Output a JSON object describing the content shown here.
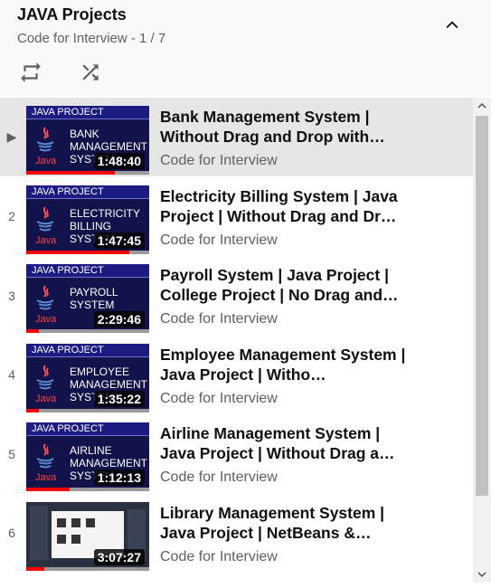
{
  "playlist": {
    "title": "JAVA Projects",
    "subtitle": "Code for Interview - 1 / 7",
    "icons": {
      "collapse": "chevron-up-icon",
      "loop": "loop-icon",
      "shuffle": "shuffle-icon",
      "now_playing": "play-arrow-icon"
    }
  },
  "items": [
    {
      "index": "▶",
      "title": "Bank Management System | Without Drag and Drop with…",
      "channel": "Code for Interview",
      "duration": "1:48:40",
      "banner": "JAVA PROJECT",
      "thumb_text": "BANK\nMANAGEMENT\nSYSTEM",
      "java": "Java",
      "progress": 0.72,
      "active": true
    },
    {
      "index": "2",
      "title": "Electricity Billing System | Java Project | Without Drag and Dr…",
      "channel": "Code for Interview",
      "duration": "1:47:45",
      "banner": "JAVA PROJECT",
      "thumb_text": "ELECTRICITY\nBILLING\nSYSTEM",
      "java": "Java",
      "progress": 0.84
    },
    {
      "index": "3",
      "title": "Payroll System | Java Project | College Project | No Drag and…",
      "channel": "Code for Interview",
      "duration": "2:29:46",
      "banner": "JAVA PROJECT",
      "thumb_text": "PAYROLL\nSYSTEM",
      "java": "Java",
      "progress": 0.1
    },
    {
      "index": "4",
      "title": "Employee Management System | Java Project | Witho…",
      "channel": "Code for Interview",
      "duration": "1:35:22",
      "banner": "JAVA PROJECT",
      "thumb_text": "EMPLOYEE\nMANAGEMENT\nSYSTEM",
      "java": "Java",
      "progress": 0.1
    },
    {
      "index": "5",
      "title": "Airline Management System | Java Project | Without Drag a…",
      "channel": "Code for Interview",
      "duration": "1:12:13",
      "banner": "JAVA PROJECT",
      "thumb_text": "AIRLINE\nMANAGEMENT\nSYSTEM",
      "java": "Java",
      "progress": 0.35
    },
    {
      "index": "6",
      "title": "Library Management System | Java Project | NetBeans &…",
      "channel": "Code for Interview",
      "duration": "3:07:27",
      "progress": 0.15,
      "screenshot": true
    }
  ],
  "colors": {
    "accent_red": "#ff0000",
    "banner_blue": "#1b1b82",
    "thumb_bg": "#13134c"
  }
}
